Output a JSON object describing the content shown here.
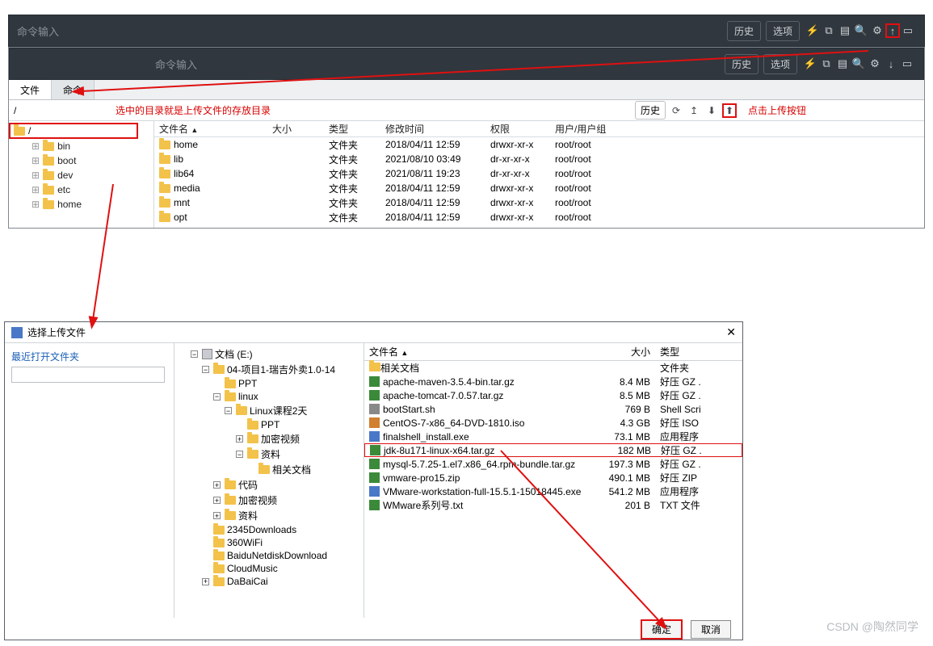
{
  "topbar1": {
    "cmd_label": "命令输入",
    "btn_history": "历史",
    "btn_options": "选项"
  },
  "topbar2": {
    "cmd_label": "命令输入",
    "btn_history": "历史",
    "btn_options": "选项"
  },
  "fm": {
    "tab_file": "文件",
    "tab_cmd": "命令",
    "path": "/",
    "root": "/",
    "history_btn": "历史",
    "annot_left": "选中的目录就是上传文件的存放目录",
    "annot_right": "点击上传按钮",
    "headers": {
      "name": "文件名",
      "size": "大小",
      "type": "类型",
      "mtime": "修改时间",
      "perm": "权限",
      "owner": "用户/用户组"
    },
    "tree": [
      "bin",
      "boot",
      "dev",
      "etc",
      "home"
    ],
    "rows": [
      {
        "name": "home",
        "type": "文件夹",
        "mtime": "2018/04/11 12:59",
        "perm": "drwxr-xr-x",
        "owner": "root/root"
      },
      {
        "name": "lib",
        "type": "文件夹",
        "mtime": "2021/08/10 03:49",
        "perm": "dr-xr-xr-x",
        "owner": "root/root"
      },
      {
        "name": "lib64",
        "type": "文件夹",
        "mtime": "2021/08/11 19:23",
        "perm": "dr-xr-xr-x",
        "owner": "root/root"
      },
      {
        "name": "media",
        "type": "文件夹",
        "mtime": "2018/04/11 12:59",
        "perm": "drwxr-xr-x",
        "owner": "root/root"
      },
      {
        "name": "mnt",
        "type": "文件夹",
        "mtime": "2018/04/11 12:59",
        "perm": "drwxr-xr-x",
        "owner": "root/root"
      },
      {
        "name": "opt",
        "type": "文件夹",
        "mtime": "2018/04/11 12:59",
        "perm": "drwxr-xr-x",
        "owner": "root/root"
      }
    ]
  },
  "dialog": {
    "title": "选择上传文件",
    "recent_label": "最近打开文件夹",
    "btn_ok": "确定",
    "btn_cancel": "取消",
    "tree": [
      {
        "d": 1,
        "exp": "-",
        "icon": "disk",
        "label": "文档 (E:)"
      },
      {
        "d": 2,
        "exp": "-",
        "icon": "f",
        "label": "04-项目1-瑞吉外卖1.0-14"
      },
      {
        "d": 3,
        "exp": "",
        "icon": "f",
        "label": "PPT"
      },
      {
        "d": 3,
        "exp": "-",
        "icon": "f",
        "label": "linux"
      },
      {
        "d": 4,
        "exp": "-",
        "icon": "f",
        "label": "Linux课程2天"
      },
      {
        "d": 5,
        "exp": "",
        "icon": "f",
        "label": "PPT"
      },
      {
        "d": 5,
        "exp": "+",
        "icon": "f",
        "label": "加密视频"
      },
      {
        "d": 5,
        "exp": "-",
        "icon": "f",
        "label": "资料"
      },
      {
        "d": 6,
        "exp": "",
        "icon": "f",
        "label": "相关文档"
      },
      {
        "d": 3,
        "exp": "+",
        "icon": "f",
        "label": "代码"
      },
      {
        "d": 3,
        "exp": "+",
        "icon": "f",
        "label": "加密视频"
      },
      {
        "d": 3,
        "exp": "+",
        "icon": "f",
        "label": "资料"
      },
      {
        "d": 2,
        "exp": "",
        "icon": "f",
        "label": "2345Downloads"
      },
      {
        "d": 2,
        "exp": "",
        "icon": "f",
        "label": "360WiFi"
      },
      {
        "d": 2,
        "exp": "",
        "icon": "f",
        "label": "BaiduNetdiskDownload"
      },
      {
        "d": 2,
        "exp": "",
        "icon": "f",
        "label": "CloudMusic"
      },
      {
        "d": 2,
        "exp": "+",
        "icon": "f",
        "label": "DaBaiCai"
      }
    ],
    "headers": {
      "name": "文件名",
      "size": "大小",
      "type": "类型"
    },
    "files": [
      {
        "name": "相关文档",
        "size": "",
        "type": "文件夹",
        "sel": false,
        "ic": "f"
      },
      {
        "name": "apache-maven-3.5.4-bin.tar.gz",
        "size": "8.4 MB",
        "type": "好压 GZ .",
        "sel": false,
        "ic": "a"
      },
      {
        "name": "apache-tomcat-7.0.57.tar.gz",
        "size": "8.5 MB",
        "type": "好压 GZ .",
        "sel": false,
        "ic": "a"
      },
      {
        "name": "bootStart.sh",
        "size": "769 B",
        "type": "Shell Scri",
        "sel": false,
        "ic": "s"
      },
      {
        "name": "CentOS-7-x86_64-DVD-1810.iso",
        "size": "4.3 GB",
        "type": "好压 ISO",
        "sel": false,
        "ic": "i"
      },
      {
        "name": "finalshell_install.exe",
        "size": "73.1 MB",
        "type": "应用程序",
        "sel": false,
        "ic": "e"
      },
      {
        "name": "jdk-8u171-linux-x64.tar.gz",
        "size": "182 MB",
        "type": "好压 GZ .",
        "sel": true,
        "ic": "a"
      },
      {
        "name": "mysql-5.7.25-1.el7.x86_64.rpm-bundle.tar.gz",
        "size": "197.3 MB",
        "type": "好压 GZ .",
        "sel": false,
        "ic": "a"
      },
      {
        "name": "vmware-pro15.zip",
        "size": "490.1 MB",
        "type": "好压 ZIP",
        "sel": false,
        "ic": "a"
      },
      {
        "name": "VMware-workstation-full-15.5.1-15018445.exe",
        "size": "541.2 MB",
        "type": "应用程序",
        "sel": false,
        "ic": "e"
      },
      {
        "name": "WMware系列号.txt",
        "size": "201 B",
        "type": "TXT 文件",
        "sel": false,
        "ic": "t"
      }
    ]
  },
  "watermark": "CSDN @陶然同学"
}
